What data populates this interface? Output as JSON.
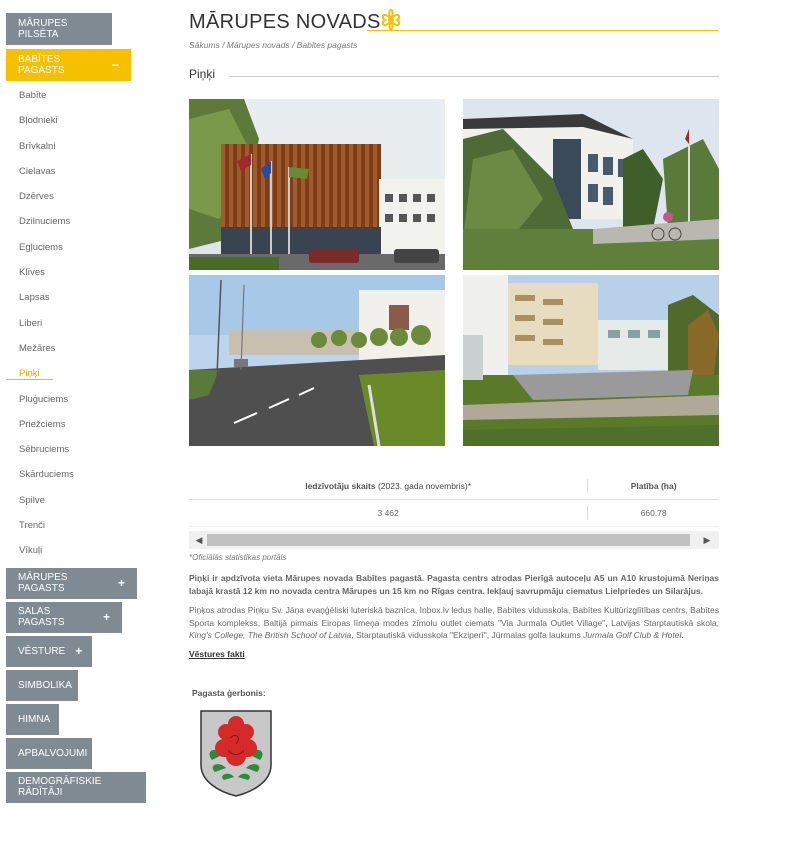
{
  "sidebar": {
    "top": "Mārupes pilsēta",
    "active": "Babītes pagasts",
    "active_icon": "minus-icon",
    "sub_items": [
      "Babīte",
      "Bļodnieki",
      "Brīvkalni",
      "Cielavas",
      "Dzērves",
      "Dzilnuciems",
      "Egļuciems",
      "Klīves",
      "Lapsas",
      "Liberi",
      "Mežāres",
      "Piņķi",
      "Pluģuciems",
      "Priežciems",
      "Sēbruciems",
      "Skārduciems",
      "Spilve",
      "Trenči",
      "Vīkuļi"
    ],
    "current_item": "Piņķi",
    "groups": [
      {
        "label": "Mārupes pagasts",
        "plus": true
      },
      {
        "label": "Salas pagasts",
        "plus": true
      },
      {
        "label": "Vēsture",
        "plus": true
      },
      {
        "label": "Simbolika",
        "plus": false
      },
      {
        "label": "Himna",
        "plus": false
      },
      {
        "label": "Apbalvojumi",
        "plus": false
      },
      {
        "label": "Demogrāfiskie rādītāji",
        "plus": false
      }
    ]
  },
  "main": {
    "title": "MĀRUPES NOVADS",
    "breadcrumb": "Sākums / Mārupes novads / Babītes pagasts",
    "section_title": "Piņķi",
    "stats": {
      "header_population_bold": "Iedzīvotāju skaits",
      "header_population_rest": " (2023. gada novembris)*",
      "header_area": "Platība (ha)",
      "population": "3 462",
      "area": "660.78"
    },
    "footnote": "*Oficiālās statistikas portāls",
    "paragraph1": "Piņķi ir apdzīvota vieta Mārupes novada Babītes pagastā. Pagasta centrs atrodas Pierīgā autoceļu A5 un A10 krustojumā Neriņas labajā krastā 12 km no novada centra Mārupes un 15 km no Rīgas centra. Iekļauj savrupmāju ciematus Lielpriedes un Silarājus.",
    "paragraph2_a": "Piņķos atrodas Piņķu Sv. Jāņa evaņģēliski luteriskā baznīca, Inbox.lv ledus halle, Babītes vidusskola, Babītes Kultūrizglītības centrs, Babītes Sporta komplekss, Baltijā pirmais Eiropas līmeņa modes zīmolu outlet ciemats \"Via Jurmala Outlet Village\", Latvijas Starptautiskā skola, ",
    "paragraph2_b": "King's College, The British School of Latvia",
    "paragraph2_c": ", Starptautiskā vidusskola \"Ekziperī\", Jūrmalas golfa laukums ",
    "paragraph2_d": "Jurmala Golf Club & Hotel",
    "paragraph2_e": ".",
    "history_link": "Vēstures fakti",
    "crest_label": "Pagasta ģerbonis:"
  },
  "colors": {
    "accent": "#f5c000",
    "nav": "#7f8a92"
  }
}
